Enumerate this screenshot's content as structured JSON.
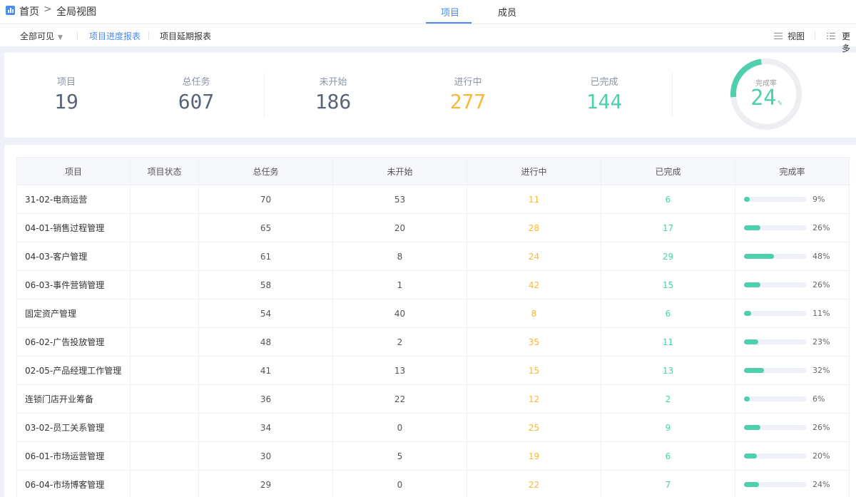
{
  "breadcrumb": {
    "home": "首页",
    "separator": ">",
    "current": "全局视图"
  },
  "main_tabs": [
    {
      "label": "项目",
      "active": true
    },
    {
      "label": "成员",
      "active": false
    }
  ],
  "sub_nav": {
    "scope": "全部可见",
    "tabs": [
      "项目进度报表",
      "项目延期报表"
    ],
    "active_index": 0,
    "view_label": "视图",
    "more_label": "更多"
  },
  "stats": {
    "items": [
      {
        "label": "项目",
        "value": "19",
        "color": "#5a6478"
      },
      {
        "label": "总任务",
        "value": "607",
        "color": "#5a6478"
      },
      {
        "label": "未开始",
        "value": "186",
        "color": "#5a6478"
      },
      {
        "label": "进行中",
        "value": "277",
        "color": "#f6b83c"
      },
      {
        "label": "已完成",
        "value": "144",
        "color": "#4ecfad"
      }
    ],
    "completion": {
      "label": "完成率",
      "value": "24",
      "unit": "%",
      "fraction": 0.24
    }
  },
  "colors": {
    "accent": "#4a8cf0",
    "done": "#4ecfad",
    "in_progress": "#f6b83c"
  },
  "table": {
    "headers": [
      "项目",
      "项目状态",
      "总任务",
      "未开始",
      "进行中",
      "已完成",
      "完成率"
    ],
    "rows": [
      {
        "name": "31-02-电商运营",
        "status": "",
        "total": "70",
        "not_started": "53",
        "in_progress": "11",
        "done": "6",
        "rate": "9%",
        "fraction": 0.09
      },
      {
        "name": "04-01-销售过程管理",
        "status": "",
        "total": "65",
        "not_started": "20",
        "in_progress": "28",
        "done": "17",
        "rate": "26%",
        "fraction": 0.26
      },
      {
        "name": "04-03-客户管理",
        "status": "",
        "total": "61",
        "not_started": "8",
        "in_progress": "24",
        "done": "29",
        "rate": "48%",
        "fraction": 0.48
      },
      {
        "name": "06-03-事件营销管理",
        "status": "",
        "total": "58",
        "not_started": "1",
        "in_progress": "42",
        "done": "15",
        "rate": "26%",
        "fraction": 0.26
      },
      {
        "name": "固定资产管理",
        "status": "",
        "total": "54",
        "not_started": "40",
        "in_progress": "8",
        "done": "6",
        "rate": "11%",
        "fraction": 0.11
      },
      {
        "name": "06-02-广告投放管理",
        "status": "",
        "total": "48",
        "not_started": "2",
        "in_progress": "35",
        "done": "11",
        "rate": "23%",
        "fraction": 0.23
      },
      {
        "name": "02-05-产品经理工作管理",
        "status": "",
        "total": "41",
        "not_started": "13",
        "in_progress": "15",
        "done": "13",
        "rate": "32%",
        "fraction": 0.32
      },
      {
        "name": "连锁门店开业筹备",
        "status": "",
        "total": "36",
        "not_started": "22",
        "in_progress": "12",
        "done": "2",
        "rate": "6%",
        "fraction": 0.06
      },
      {
        "name": "03-02-员工关系管理",
        "status": "",
        "total": "34",
        "not_started": "0",
        "in_progress": "25",
        "done": "9",
        "rate": "26%",
        "fraction": 0.26
      },
      {
        "name": "06-01-市场运营管理",
        "status": "",
        "total": "30",
        "not_started": "5",
        "in_progress": "19",
        "done": "6",
        "rate": "20%",
        "fraction": 0.2
      },
      {
        "name": "06-04-市场博客管理",
        "status": "",
        "total": "29",
        "not_started": "0",
        "in_progress": "22",
        "done": "7",
        "rate": "24%",
        "fraction": 0.24
      }
    ]
  }
}
